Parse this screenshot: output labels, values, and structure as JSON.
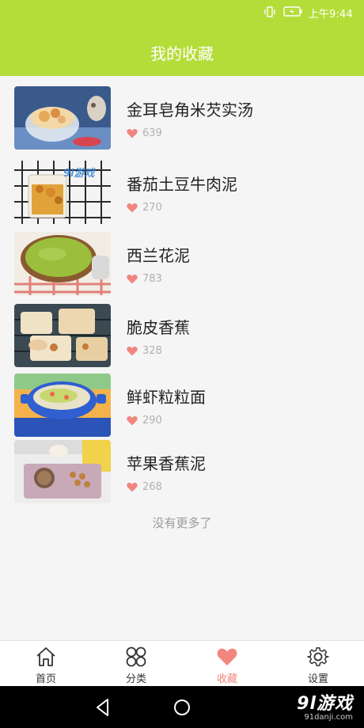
{
  "status_bar": {
    "time": "上午9:44"
  },
  "header": {
    "title": "我的收藏"
  },
  "favorites": [
    {
      "title": "金耳皂角米芡实汤",
      "likes": "639"
    },
    {
      "title": "番茄土豆牛肉泥",
      "likes": "270"
    },
    {
      "title": "西兰花泥",
      "likes": "783"
    },
    {
      "title": "脆皮香蕉",
      "likes": "328"
    },
    {
      "title": "鲜虾粒粒面",
      "likes": "290"
    },
    {
      "title": "苹果香蕉泥",
      "likes": "268"
    }
  ],
  "end_message": "没有更多了",
  "bottom_nav": [
    {
      "label": "首页",
      "icon": "home-icon"
    },
    {
      "label": "分类",
      "icon": "category-icon"
    },
    {
      "label": "收藏",
      "icon": "heart-icon",
      "active": true
    },
    {
      "label": "设置",
      "icon": "gear-icon"
    }
  ],
  "watermark": {
    "logo": "9l游戏",
    "url": "91danji.com"
  },
  "colors": {
    "header": "#b5dd3a",
    "accent": "#f0867e",
    "background": "#f5f5f5"
  }
}
